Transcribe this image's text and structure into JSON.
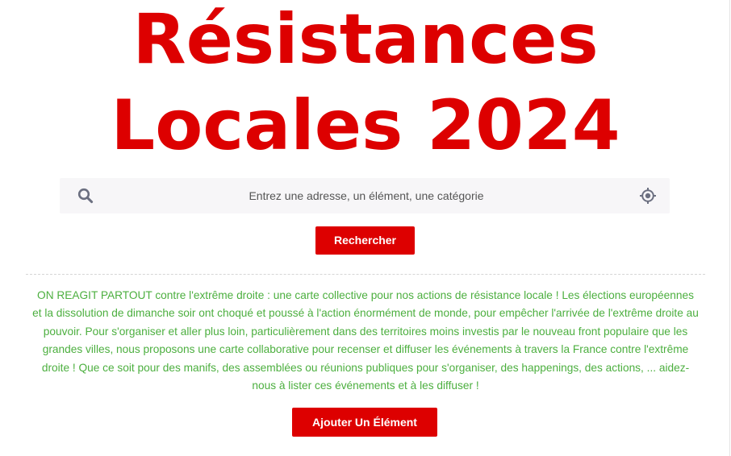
{
  "header": {
    "title_line1": "Résistances",
    "title_line2": "Locales 2024"
  },
  "search": {
    "placeholder": "Entrez une adresse, un élément, une catégorie",
    "search_icon": "search-icon",
    "locate_icon": "crosshair-locate-icon",
    "button_label": "Rechercher"
  },
  "intro": {
    "text": "ON REAGIT PARTOUT contre l'extrême droite : une carte collective pour nos actions de résistance locale ! Les élections européennes et la dissolution de dimanche soir ont choqué et poussé à l'action énormément de monde, pour empêcher l'arrivée de l'extrême droite au pouvoir. Pour s'organiser et aller plus loin, particulièrement dans des territoires moins investis par le nouveau front populaire que les grandes villes, nous proposons une carte collaborative pour recenser et diffuser les événements à travers la France contre l'extrême droite ! Que ce soit pour des manifs, des assemblées ou réunions publiques pour s'organiser, des happenings, des actions, ... aidez-nous à lister ces événements et à les diffuser !"
  },
  "actions": {
    "add_element_label": "Ajouter Un Élément"
  },
  "colors": {
    "accent": "#dd0000",
    "intro_text": "#4caf3f",
    "search_bg": "#f7f6f8",
    "icon_gray": "#6b6f80"
  }
}
